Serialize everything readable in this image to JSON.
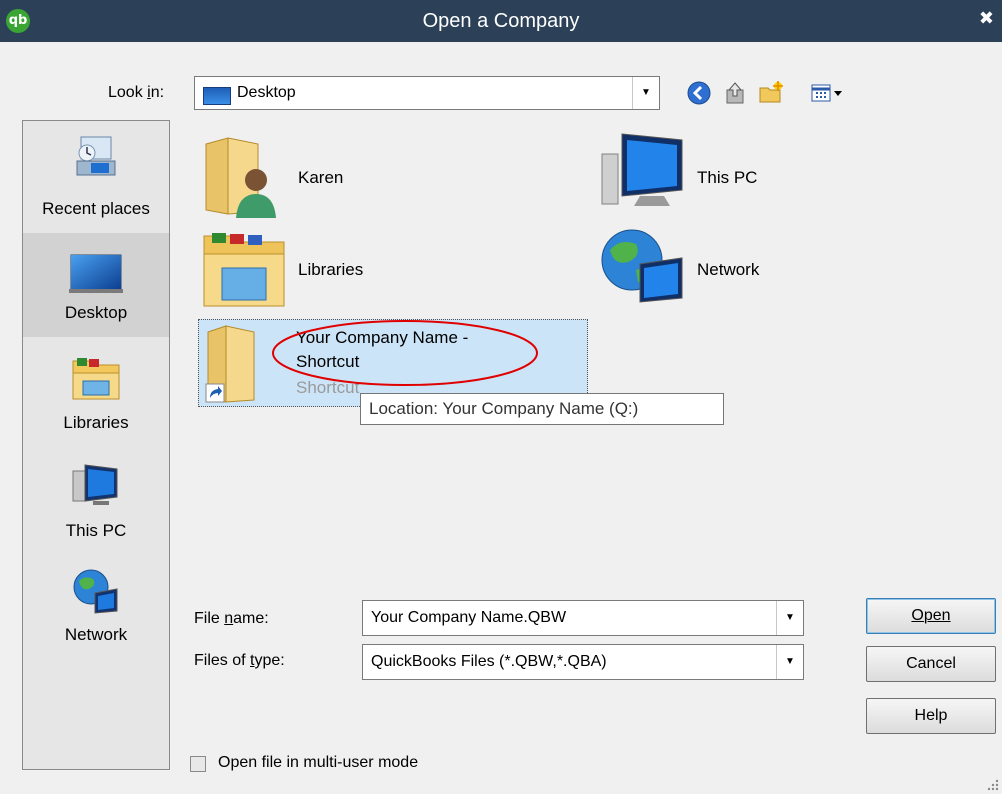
{
  "window": {
    "title": "Open a Company",
    "logo_text": "qb",
    "close_glyph": "✖"
  },
  "lookin": {
    "label": "Look in:",
    "label_underline": "i",
    "value": "Desktop"
  },
  "toolbar": {
    "icons": [
      "back-icon",
      "up-folder-icon",
      "new-folder-icon",
      "view-menu-icon"
    ]
  },
  "places": {
    "items": [
      {
        "label": "Recent places",
        "icon": "recent-places-icon"
      },
      {
        "label": "Desktop",
        "icon": "desktop-icon"
      },
      {
        "label": "Libraries",
        "icon": "libraries-icon"
      },
      {
        "label": "This PC",
        "icon": "this-pc-icon"
      },
      {
        "label": "Network",
        "icon": "network-icon"
      }
    ]
  },
  "files": {
    "items": [
      {
        "name": "Karen",
        "icon": "user-folder-icon"
      },
      {
        "name": "This PC",
        "icon": "this-pc-icon"
      },
      {
        "name": "Libraries",
        "icon": "libraries-folder-icon"
      },
      {
        "name": "Network",
        "icon": "network-icon"
      },
      {
        "name_line1": "Your Company Name -",
        "name_line2": "Shortcut",
        "subtitle": "Shortcut",
        "icon": "shortcut-folder-icon"
      }
    ],
    "tooltip": "Location: Your Company Name (Q:)"
  },
  "form": {
    "filename_label": "File name:",
    "filename_value": "Your Company Name.QBW",
    "filetype_label": "Files of type:",
    "filetype_value": "QuickBooks Files (*.QBW,*.QBA)"
  },
  "buttons": {
    "open": "Open",
    "cancel": "Cancel",
    "help": "Help"
  },
  "multiuser": {
    "label": "Open file in multi-user mode"
  },
  "colors": {
    "titlebar": "#2c4158",
    "selection": "#cce4f7",
    "annotation": "#e00000"
  }
}
